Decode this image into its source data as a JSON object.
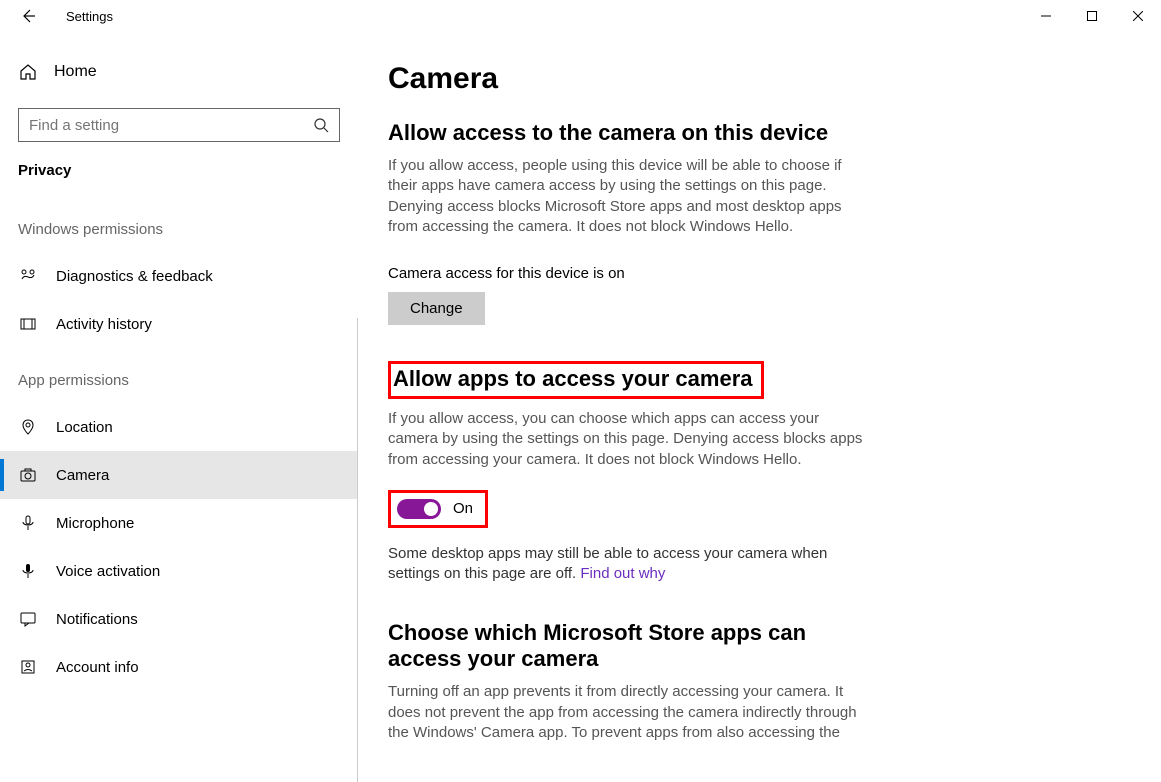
{
  "window": {
    "title": "Settings"
  },
  "sidebar": {
    "home": "Home",
    "search_placeholder": "Find a setting",
    "category": "Privacy",
    "groups": [
      {
        "label": "Windows permissions",
        "items": [
          {
            "icon": "diagnostics",
            "label": "Diagnostics & feedback"
          },
          {
            "icon": "activity",
            "label": "Activity history"
          }
        ]
      },
      {
        "label": "App permissions",
        "items": [
          {
            "icon": "location",
            "label": "Location"
          },
          {
            "icon": "camera",
            "label": "Camera",
            "selected": true
          },
          {
            "icon": "microphone",
            "label": "Microphone"
          },
          {
            "icon": "voice",
            "label": "Voice activation"
          },
          {
            "icon": "notifications",
            "label": "Notifications"
          },
          {
            "icon": "account",
            "label": "Account info"
          }
        ]
      }
    ]
  },
  "main": {
    "title": "Camera",
    "sections": {
      "device_access": {
        "title": "Allow access to the camera on this device",
        "desc": "If you allow access, people using this device will be able to choose if their apps have camera access by using the settings on this page. Denying access blocks Microsoft Store apps and most desktop apps from accessing the camera. It does not block Windows Hello.",
        "status": "Camera access for this device is on",
        "change_btn": "Change"
      },
      "app_access": {
        "title": "Allow apps to access your camera",
        "desc": "If you allow access, you can choose which apps can access your camera by using the settings on this page. Denying access blocks apps from accessing your camera. It does not block Windows Hello.",
        "toggle_state": "On",
        "note_before": "Some desktop apps may still be able to access your camera when settings on this page are off. ",
        "note_link": "Find out why"
      },
      "choose_apps": {
        "title": "Choose which Microsoft Store apps can access your camera",
        "desc": "Turning off an app prevents it from directly accessing your camera. It does not prevent the app from accessing the camera indirectly through the Windows' Camera app. To prevent apps from also accessing the"
      }
    }
  }
}
